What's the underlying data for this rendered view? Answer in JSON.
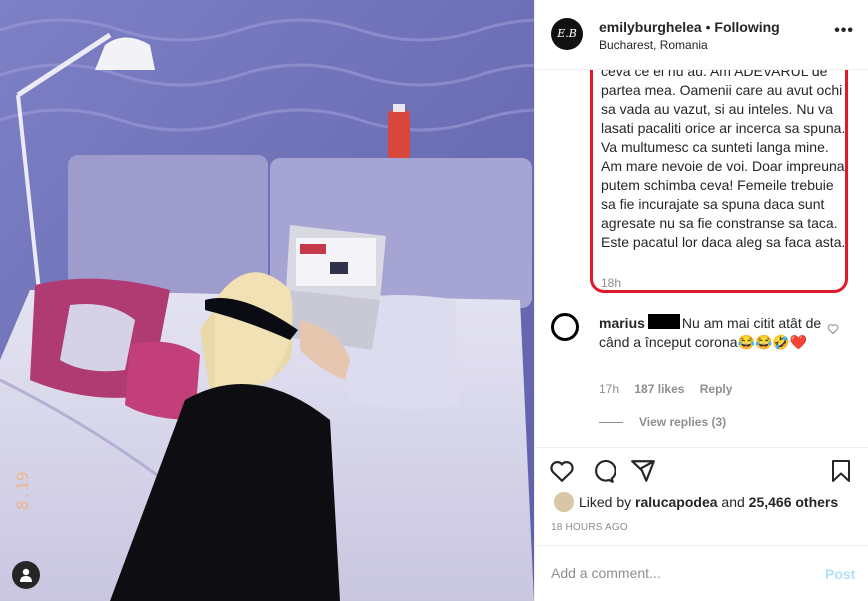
{
  "post": {
    "username": "emilyburghelea",
    "separator": "•",
    "follow_status": "Following",
    "location": "Bucharest, Romania",
    "avatar_initials": "E.B",
    "more_icon": "more-options-icon",
    "more_label": "•••"
  },
  "caption": {
    "text": "ceva ce el nu au. Am ADEVARUL de partea mea. Oamenii care au avut ochi sa vada au vazut, si au inteles. Nu va lasati pacaliti orice ar incerca sa spuna. Va multumesc ca sunteti langa mine. Am mare nevoie de voi. Doar impreuna putem schimba ceva! Femeile trebuie sa fie incurajate sa spuna daca sunt agresate nu sa fie constranse sa taca. Este pacatul lor daca aleg sa faca asta.",
    "time": "18h",
    "highlight_color": "#e0192a"
  },
  "comment": {
    "username": "marius",
    "text": "Nu am mai citit atât de când a început corona😂😂🤣❤️",
    "time": "17h",
    "likes": "187 likes",
    "reply_label": "Reply",
    "view_replies": "View replies (3)"
  },
  "actions": {
    "icons": [
      "heart-icon",
      "comment-icon",
      "share-icon",
      "bookmark-icon"
    ]
  },
  "likes": {
    "prefix": "Liked by ",
    "user": "ralucapodea",
    "middle": " and ",
    "others": "25,466 others"
  },
  "timestamp": "18 HOURS AGO",
  "add_comment": {
    "placeholder": "Add a comment...",
    "post_label": "Post"
  },
  "colors": {
    "text": "#262626",
    "secondary": "#8e8e8e",
    "post_button": "#b2dffc"
  }
}
